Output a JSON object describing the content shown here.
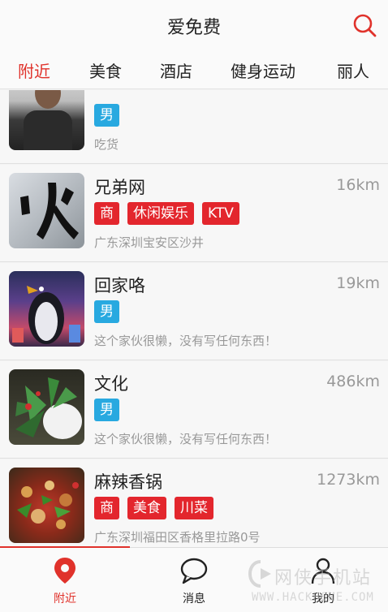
{
  "header": {
    "title": "爱免费",
    "search_icon": "search-icon"
  },
  "tabs": [
    {
      "label": "附近",
      "active": true
    },
    {
      "label": "美食"
    },
    {
      "label": "酒店"
    },
    {
      "label": "健身运动"
    },
    {
      "label": "丽人"
    }
  ],
  "items": [
    {
      "name": "",
      "distance": "",
      "tags": [
        "男"
      ],
      "desc": "吃货"
    },
    {
      "name": "兄弟网",
      "distance": "16km",
      "tags": [
        "商",
        "休闲娱乐",
        "KTV"
      ],
      "desc": "广东深圳宝安区沙井"
    },
    {
      "name": "回家咯",
      "distance": "19km",
      "tags": [
        "男"
      ],
      "desc": "这个家伙很懒，没有写任何东西！"
    },
    {
      "name": "文化",
      "distance": "486km",
      "tags": [
        "男"
      ],
      "desc": "这个家伙很懒，没有写任何东西！"
    },
    {
      "name": "麻辣香锅",
      "distance": "1273km",
      "tags": [
        "商",
        "美食",
        "川菜"
      ],
      "desc": "广东深圳福田区香格里拉路0号"
    }
  ],
  "bottom_nav": [
    {
      "label": "附近",
      "icon": "location-pin-icon",
      "active": true
    },
    {
      "label": "消息",
      "icon": "chat-bubble-icon"
    },
    {
      "label": "我的",
      "icon": "person-icon"
    }
  ],
  "watermark": {
    "line1": "网侠手机站",
    "line2": "WWW.HACKHOME.COM"
  },
  "colors": {
    "accent": "#e0322b",
    "gender_tag": "#28a9e0",
    "shop_tag": "#e3262d"
  }
}
